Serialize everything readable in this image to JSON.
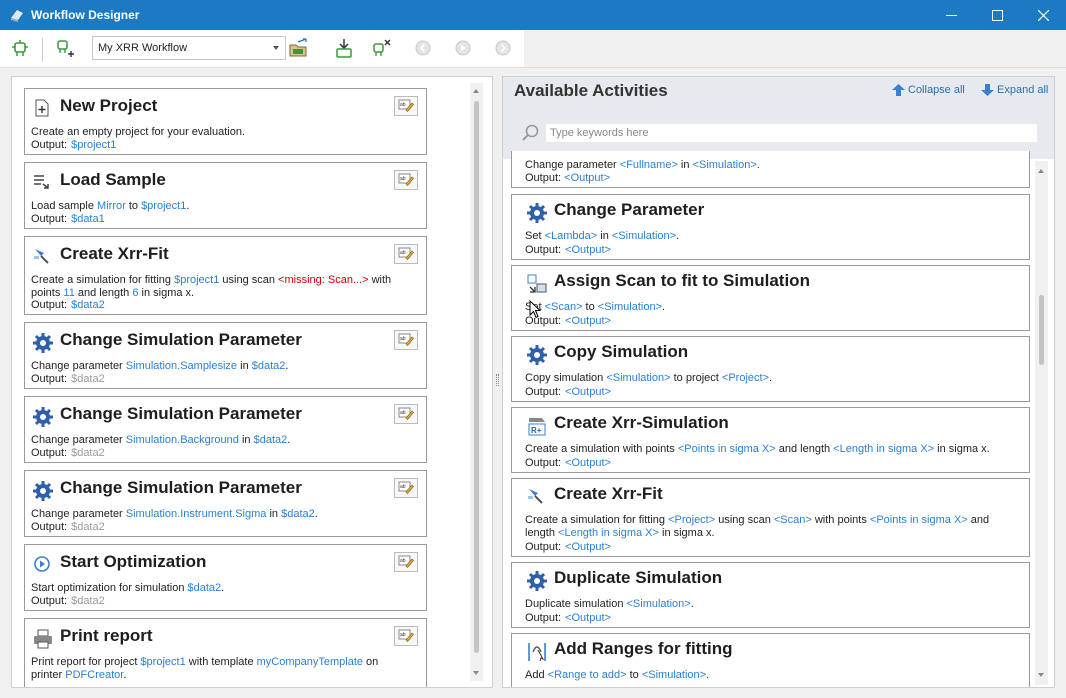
{
  "window": {
    "title": "Workflow Designer"
  },
  "toolbar": {
    "workflow_select": "My XRR Workflow",
    "icons": [
      "new-workflow-icon",
      "add-activity-icon",
      "open-workflow-icon",
      "import-icon",
      "delete-icon",
      "back-icon",
      "play-icon",
      "forward-icon"
    ]
  },
  "workflow": {
    "cards": [
      {
        "title": "New Project",
        "icon": "new-project-icon",
        "desc": [
          {
            "t": "Create an empty project for your evaluation."
          }
        ],
        "output_label": "Output:",
        "output": "$project1",
        "output_style": "blue"
      },
      {
        "title": "Load Sample",
        "icon": "load-sample-icon",
        "desc": [
          {
            "t": "Load sample "
          },
          {
            "t": "Mirror",
            "c": "blue"
          },
          {
            "t": " to "
          },
          {
            "t": "$project1",
            "c": "blue"
          },
          {
            "t": "."
          }
        ],
        "output_label": "Output:",
        "output": "$data1",
        "output_style": "blue"
      },
      {
        "title": "Create Xrr-Fit",
        "icon": "create-xrr-fit-icon",
        "desc": [
          {
            "t": "Create a simulation for fitting "
          },
          {
            "t": "$project1",
            "c": "blue"
          },
          {
            "t": " using scan "
          },
          {
            "t": "<missing: Scan...>",
            "c": "red"
          },
          {
            "t": " with  points "
          },
          {
            "t": "11",
            "c": "blue"
          },
          {
            "t": " and length "
          },
          {
            "t": "6",
            "c": "blue"
          },
          {
            "t": " in sigma x."
          }
        ],
        "output_label": "Output:",
        "output": "$data2",
        "output_style": "blue"
      },
      {
        "title": "Change Simulation Parameter",
        "icon": "gear-icon",
        "desc": [
          {
            "t": "Change parameter "
          },
          {
            "t": "Simulation.Samplesize",
            "c": "blue"
          },
          {
            "t": " in "
          },
          {
            "t": "$data2",
            "c": "blue"
          },
          {
            "t": "."
          }
        ],
        "output_label": "Output:",
        "output": "$data2",
        "output_style": "grey"
      },
      {
        "title": "Change Simulation Parameter",
        "icon": "gear-icon",
        "desc": [
          {
            "t": "Change parameter "
          },
          {
            "t": "Simulation.Background",
            "c": "blue"
          },
          {
            "t": " in "
          },
          {
            "t": "$data2",
            "c": "blue"
          },
          {
            "t": "."
          }
        ],
        "output_label": "Output:",
        "output": "$data2",
        "output_style": "grey"
      },
      {
        "title": "Change Simulation Parameter",
        "icon": "gear-icon",
        "desc": [
          {
            "t": "Change parameter "
          },
          {
            "t": "Simulation.Instrument.Sigma",
            "c": "blue"
          },
          {
            "t": " in "
          },
          {
            "t": "$data2",
            "c": "blue"
          },
          {
            "t": "."
          }
        ],
        "output_label": "Output:",
        "output": "$data2",
        "output_style": "grey"
      },
      {
        "title": "Start Optimization",
        "icon": "play-circle-icon",
        "desc": [
          {
            "t": "Start optimization for simulation "
          },
          {
            "t": "$data2",
            "c": "blue"
          },
          {
            "t": "."
          }
        ],
        "output_label": "Output:",
        "output": "$data2",
        "output_style": "grey"
      },
      {
        "title": "Print report",
        "icon": "printer-icon",
        "desc": [
          {
            "t": "Print report for project "
          },
          {
            "t": "$project1",
            "c": "blue"
          },
          {
            "t": " with template "
          },
          {
            "t": "myCompanyTemplate",
            "c": "blue"
          },
          {
            "t": " on printer "
          },
          {
            "t": "PDFCreator",
            "c": "blue"
          },
          {
            "t": "."
          }
        ],
        "output_label": "",
        "output": "",
        "output_style": "blue"
      }
    ]
  },
  "activities": {
    "title": "Available Activities",
    "collapse_all": "Collapse all",
    "expand_all": "Expand all",
    "search_placeholder": "Type keywords here",
    "partial_top": {
      "desc": [
        {
          "t": "Change parameter "
        },
        {
          "t": "<Fullname>",
          "c": "blue"
        },
        {
          "t": " in "
        },
        {
          "t": "<Simulation>",
          "c": "blue"
        },
        {
          "t": "."
        }
      ],
      "output_label": "Output:",
      "output": "<Output>"
    },
    "items": [
      {
        "title": "Change Parameter",
        "icon": "gear-icon",
        "desc": [
          {
            "t": "Set "
          },
          {
            "t": "<Lambda>",
            "c": "blue"
          },
          {
            "t": " in "
          },
          {
            "t": "<Simulation>",
            "c": "blue"
          },
          {
            "t": "."
          }
        ],
        "output_label": "Output:",
        "output": "<Output>"
      },
      {
        "title": "Assign Scan to fit to Simulation",
        "icon": "assign-scan-icon",
        "desc": [
          {
            "t": "Set "
          },
          {
            "t": "<Scan>",
            "c": "blue"
          },
          {
            "t": " to "
          },
          {
            "t": "<Simulation>",
            "c": "blue"
          },
          {
            "t": "."
          }
        ],
        "output_label": "Output:",
        "output": "<Output>"
      },
      {
        "title": "Copy Simulation",
        "icon": "gear-icon",
        "desc": [
          {
            "t": "Copy simulation "
          },
          {
            "t": "<Simulation>",
            "c": "blue"
          },
          {
            "t": " to project "
          },
          {
            "t": "<Project>",
            "c": "blue"
          },
          {
            "t": "."
          }
        ],
        "output_label": "Output:",
        "output": "<Output>"
      },
      {
        "title": "Create Xrr-Simulation",
        "icon": "create-xrr-sim-icon",
        "desc": [
          {
            "t": "Create a simulation with points "
          },
          {
            "t": "<Points in sigma X>",
            "c": "blue"
          },
          {
            "t": " and length "
          },
          {
            "t": "<Length in sigma X>",
            "c": "blue"
          },
          {
            "t": " in sigma x."
          }
        ],
        "output_label": "Output:",
        "output": "<Output>"
      },
      {
        "title": "Create Xrr-Fit",
        "icon": "create-xrr-fit-icon",
        "desc": [
          {
            "t": "Create a simulation for fitting "
          },
          {
            "t": "<Project>",
            "c": "blue"
          },
          {
            "t": " using scan "
          },
          {
            "t": "<Scan>",
            "c": "blue"
          },
          {
            "t": " with points "
          },
          {
            "t": "<Points in sigma X>",
            "c": "blue"
          },
          {
            "t": " and  length "
          },
          {
            "t": "<Length in sigma X>",
            "c": "blue"
          },
          {
            "t": " in sigma x."
          }
        ],
        "output_label": "Output:",
        "output": "<Output>"
      },
      {
        "title": "Duplicate Simulation",
        "icon": "gear-icon",
        "desc": [
          {
            "t": "Duplicate simulation "
          },
          {
            "t": "<Simulation>",
            "c": "blue"
          },
          {
            "t": "."
          }
        ],
        "output_label": "Output:",
        "output": "<Output>"
      },
      {
        "title": "Add Ranges for fitting",
        "icon": "add-ranges-icon",
        "desc": [
          {
            "t": "Add "
          },
          {
            "t": "<Range to add>",
            "c": "blue"
          },
          {
            "t": " to "
          },
          {
            "t": "<Simulation>",
            "c": "blue"
          },
          {
            "t": "."
          }
        ],
        "output_label": "",
        "output": ""
      }
    ]
  },
  "colors": {
    "titlebar": "#1b7ac2",
    "link": "#2a7fd4",
    "missing": "#d40000",
    "muted": "#9a9a9a"
  }
}
